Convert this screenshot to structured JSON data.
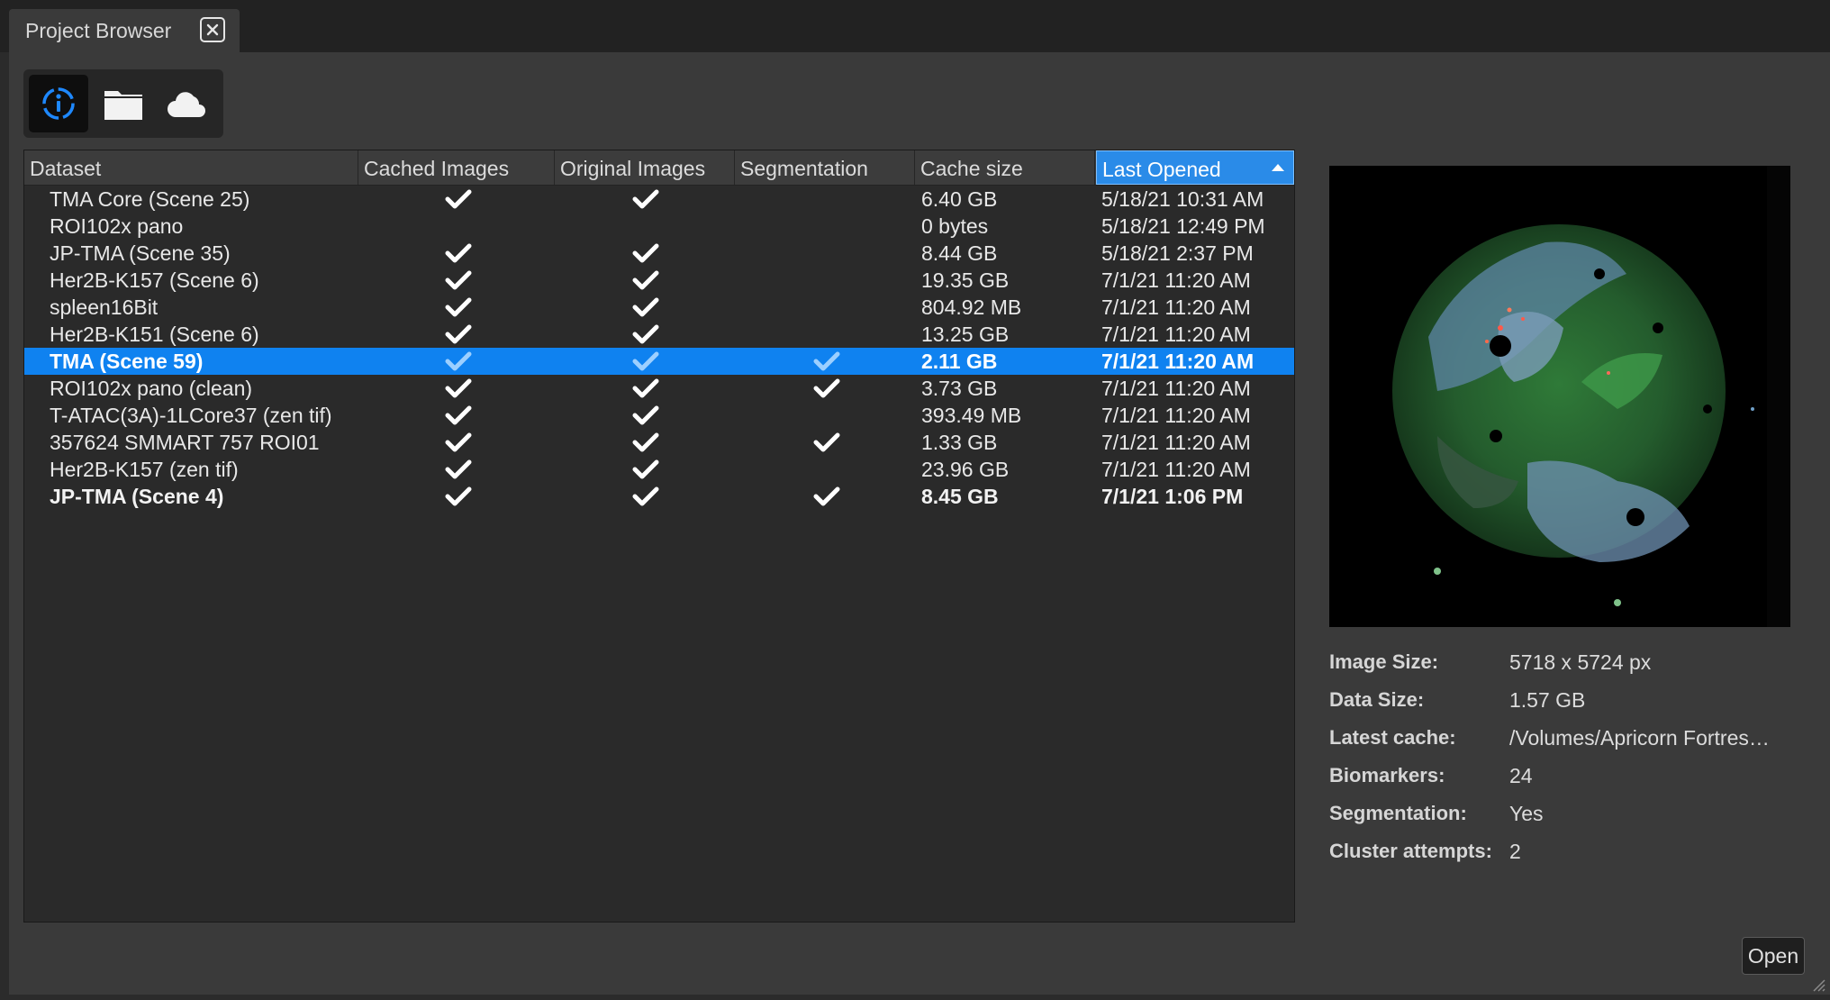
{
  "tab": {
    "title": "Project Browser"
  },
  "toolbar": {
    "tools": [
      "info-icon",
      "folder-icon",
      "cloud-icon"
    ],
    "active": "info-icon"
  },
  "table": {
    "columns": [
      "Dataset",
      "Cached Images",
      "Original Images",
      "Segmentation",
      "Cache size",
      "Last Opened"
    ],
    "sorted_column": "Last Opened",
    "sort_direction": "ascending",
    "rows": [
      {
        "dataset": "TMA Core (Scene 25)",
        "cached": true,
        "original": true,
        "segmentation": false,
        "size": "6.40 GB",
        "opened": "5/18/21 10:31 AM"
      },
      {
        "dataset": "ROI102x pano",
        "cached": false,
        "original": false,
        "segmentation": false,
        "size": "0 bytes",
        "opened": "5/18/21 12:49 PM"
      },
      {
        "dataset": "JP-TMA (Scene 35)",
        "cached": true,
        "original": true,
        "segmentation": false,
        "size": "8.44 GB",
        "opened": "5/18/21 2:37 PM"
      },
      {
        "dataset": "Her2B-K157 (Scene 6)",
        "cached": true,
        "original": true,
        "segmentation": false,
        "size": "19.35 GB",
        "opened": "7/1/21 11:20 AM"
      },
      {
        "dataset": "spleen16Bit",
        "cached": true,
        "original": true,
        "segmentation": false,
        "size": "804.92 MB",
        "opened": "7/1/21 11:20 AM"
      },
      {
        "dataset": "Her2B-K151 (Scene 6)",
        "cached": true,
        "original": true,
        "segmentation": false,
        "size": "13.25 GB",
        "opened": "7/1/21 11:20 AM"
      },
      {
        "dataset": "TMA (Scene 59)",
        "cached": true,
        "original": true,
        "segmentation": true,
        "size": "2.11 GB",
        "opened": "7/1/21 11:20 AM",
        "selected": true
      },
      {
        "dataset": "ROI102x pano (clean)",
        "cached": true,
        "original": true,
        "segmentation": true,
        "size": "3.73 GB",
        "opened": "7/1/21 11:20 AM"
      },
      {
        "dataset": "T-ATAC(3A)-1LCore37 (zen tif)",
        "cached": true,
        "original": true,
        "segmentation": false,
        "size": "393.49 MB",
        "opened": "7/1/21 11:20 AM"
      },
      {
        "dataset": "357624 SMMART 757 ROI01",
        "cached": true,
        "original": true,
        "segmentation": true,
        "size": "1.33 GB",
        "opened": "7/1/21 11:20 AM"
      },
      {
        "dataset": "Her2B-K157 (zen tif)",
        "cached": true,
        "original": true,
        "segmentation": false,
        "size": "23.96 GB",
        "opened": "7/1/21 11:20 AM"
      },
      {
        "dataset": "JP-TMA (Scene 4)",
        "cached": true,
        "original": true,
        "segmentation": true,
        "size": "8.45 GB",
        "opened": "7/1/21 1:06 PM",
        "bold": true
      }
    ]
  },
  "details": [
    {
      "label": "Image Size:",
      "value": "5718 x 5724 px"
    },
    {
      "label": "Data Size:",
      "value": "1.57 GB"
    },
    {
      "label": "Latest cache:",
      "value": "/Volumes/Apricorn Fortres…"
    },
    {
      "label": "Biomarkers:",
      "value": "24"
    },
    {
      "label": "Segmentation:",
      "value": "Yes"
    },
    {
      "label": "Cluster attempts:",
      "value": "2"
    }
  ],
  "open_button": {
    "label": "Open"
  },
  "colors": {
    "accent": "#0f82f0",
    "panel": "#3a3a3a",
    "table_bg": "#2a2a2a",
    "selected_check": "#9ccfff"
  }
}
